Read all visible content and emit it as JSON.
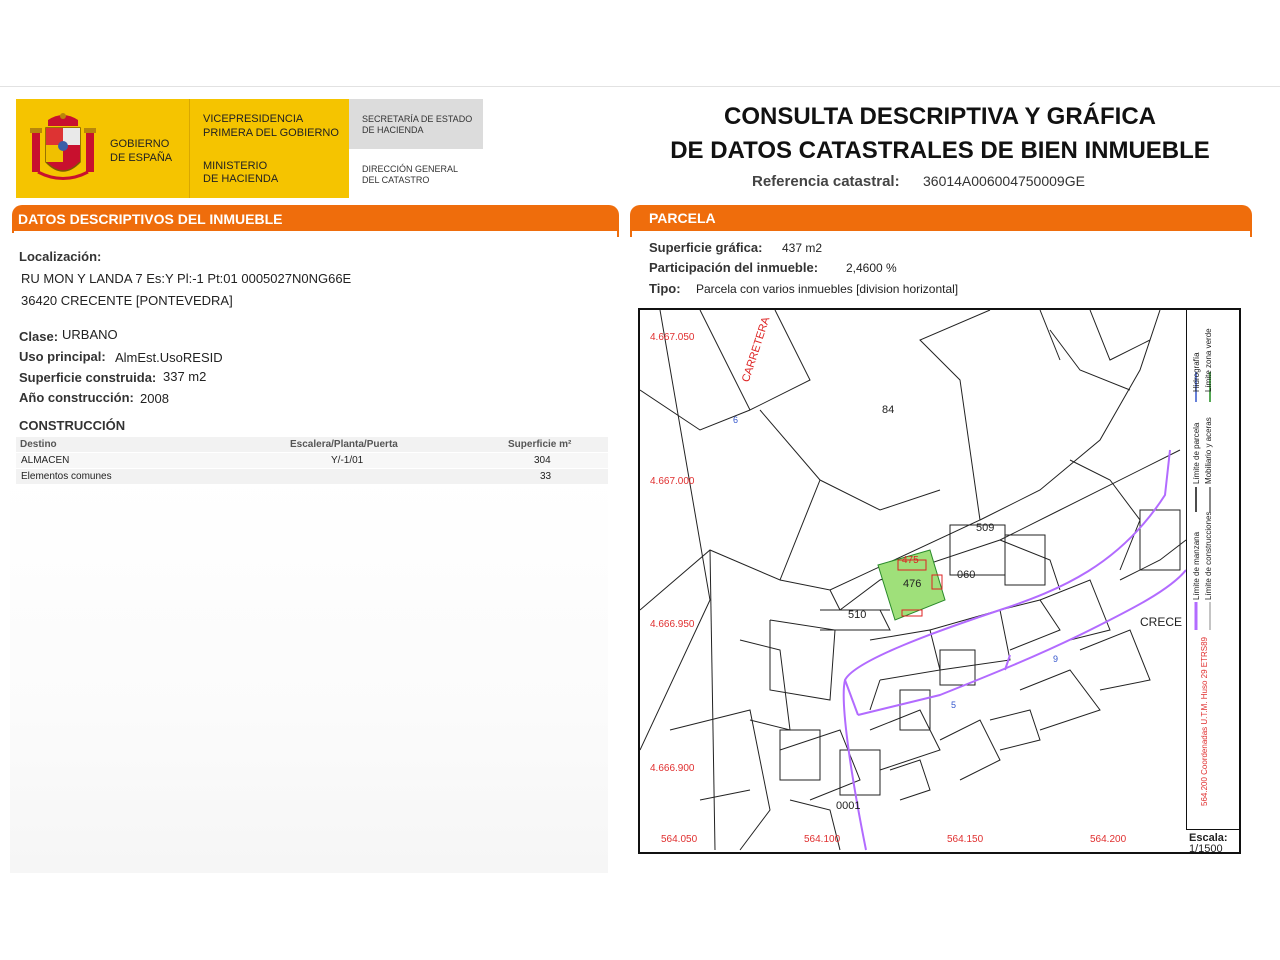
{
  "header": {
    "gov_line1": "GOBIERNO",
    "gov_line2": "DE ESPAÑA",
    "vp_line1": "VICEPRESIDENCIA",
    "vp_line2": "PRIMERA DEL GOBIERNO",
    "min_line1": "MINISTERIO",
    "min_line2": "DE HACIENDA",
    "se_line1": "SECRETARÍA DE ESTADO",
    "se_line2": "DE HACIENDA",
    "dg_line1": "DIRECCIÓN GENERAL",
    "dg_line2": "DEL CATASTRO",
    "title_line1": "CONSULTA DESCRIPTIVA Y GRÁFICA",
    "title_line2": "DE DATOS CATASTRALES DE BIEN INMUEBLE",
    "ref_label": "Referencia catastral:",
    "ref_value": "36014A006004750009GE"
  },
  "colors": {
    "accent": "#ef6d0c",
    "brand_yellow": "#f5c400",
    "parcel_green": "#9fe07a",
    "road_purple": "#b26bff",
    "coord_red": "#e03030"
  },
  "datos": {
    "tab_label": "DATOS DESCRIPTIVOS DEL INMUEBLE",
    "localizacion_label": "Localización:",
    "address_line1": "RU MON Y LANDA 7 Es:Y Pl:-1 Pt:01 0005027N0NG66E",
    "address_line2": "36420 CRECENTE [PONTEVEDRA]",
    "clase_label": "Clase:",
    "clase_value": "URBANO",
    "uso_label": "Uso principal:",
    "uso_value": "AlmEst.UsoRESID",
    "sup_label": "Superficie construida:",
    "sup_value": "337 m2",
    "anio_label": "Año construcción:",
    "anio_value": "2008",
    "construccion_title": "CONSTRUCCIÓN",
    "table": {
      "headers": [
        "Destino",
        "Escalera/Planta/Puerta",
        "Superficie m²"
      ],
      "rows": [
        [
          "ALMACEN",
          "Y/-1/01",
          "304"
        ],
        [
          "Elementos comunes",
          "",
          "33"
        ]
      ]
    }
  },
  "parcela": {
    "tab_label": "PARCELA",
    "sup_label": "Superficie gráfica:",
    "sup_value": "437 m2",
    "part_label": "Participación del inmueble:",
    "part_value": "2,4600 %",
    "tipo_label": "Tipo:",
    "tipo_value": "Parcela con varios inmuebles [division horizontal]"
  },
  "map": {
    "y_coords": [
      "4.667.050",
      "4.667.000",
      "4.666.950",
      "4.666.900"
    ],
    "x_coords": [
      "564.050",
      "564.100",
      "564.150",
      "564.200"
    ],
    "parcel_labels": [
      "84",
      "509",
      "060",
      "476",
      "510",
      "0001",
      "5",
      "9",
      "6",
      "475"
    ],
    "road_labels": [
      "CARRETERA",
      "CRECE"
    ],
    "legend": [
      "Hidrografía",
      "Límite zona verde",
      "Límite de parcela",
      "Mobiliario y aceras",
      "Límite de manzana",
      "Límite de construcciones",
      "564.200 Coordenadas U.T.M. Huso 29 ETRS89"
    ],
    "scale_label": "Escala:",
    "scale_value": "1/1500"
  }
}
